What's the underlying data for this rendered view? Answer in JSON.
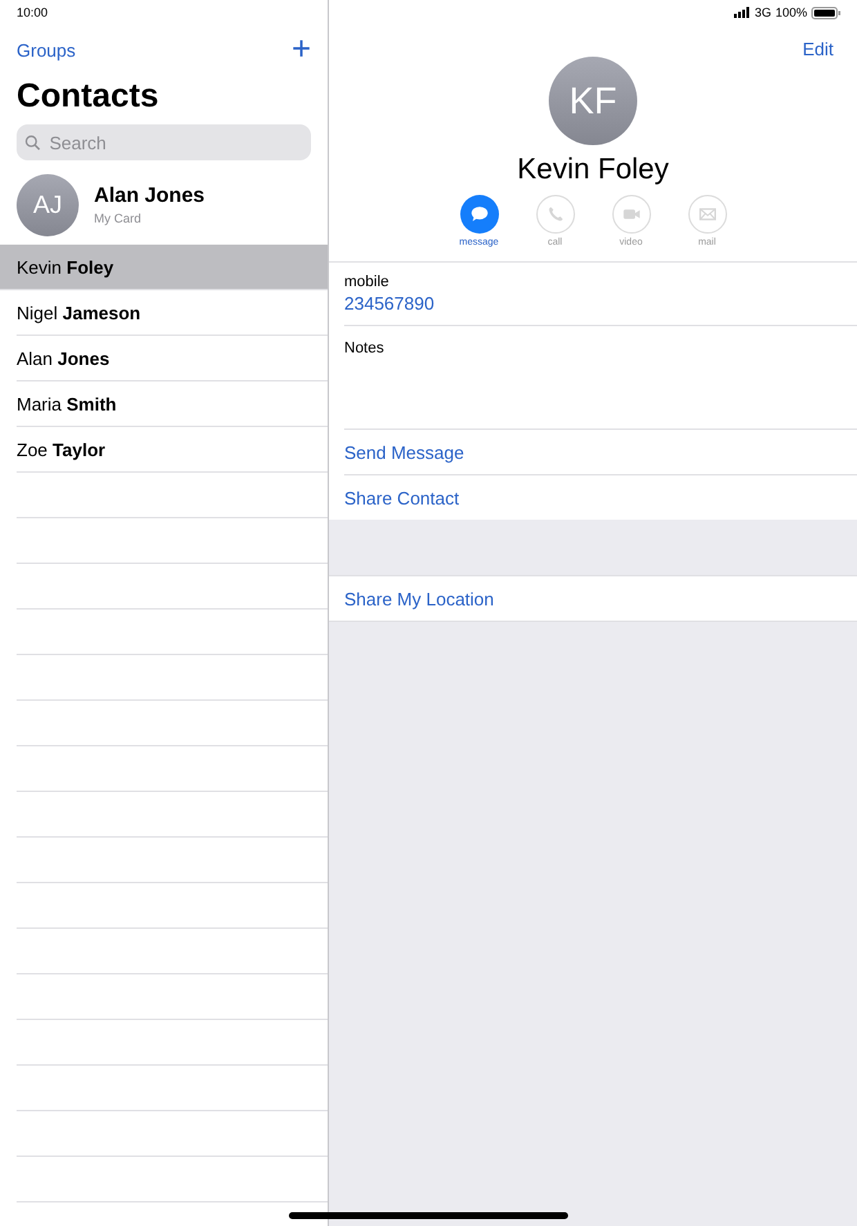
{
  "status_bar": {
    "time": "10:00",
    "network": "3G",
    "battery": "100%"
  },
  "sidebar": {
    "groups_link": "Groups",
    "add_button": "+",
    "title": "Contacts",
    "search": {
      "placeholder": "Search"
    },
    "my_card": {
      "initials": "AJ",
      "name": "Alan Jones",
      "subtitle": "My Card"
    },
    "contacts": [
      {
        "name": "Kevin **Foley**",
        "selected": true
      },
      {
        "name": "Nigel **Jameson**",
        "selected": false
      },
      {
        "name": "Alan **Jones**",
        "selected": false
      },
      {
        "name": "Maria **Smith**",
        "selected": false
      },
      {
        "name": "Zoe **Taylor**",
        "selected": false
      }
    ]
  },
  "detail": {
    "edit_button": "Edit",
    "initials": "KF",
    "name": "Kevin Foley",
    "actions": [
      {
        "kind": "message",
        "label": "message",
        "disabled": false
      },
      {
        "kind": "call",
        "label": "call",
        "disabled": true
      },
      {
        "kind": "video",
        "label": "video",
        "disabled": true
      },
      {
        "kind": "mail",
        "label": "mail",
        "disabled": true
      }
    ],
    "phone": {
      "label": "mobile",
      "value": "234567890"
    },
    "notes": {
      "label": "Notes"
    },
    "links": [
      "Send Message",
      "Share Contact"
    ],
    "location_link": "Share My Location"
  }
}
